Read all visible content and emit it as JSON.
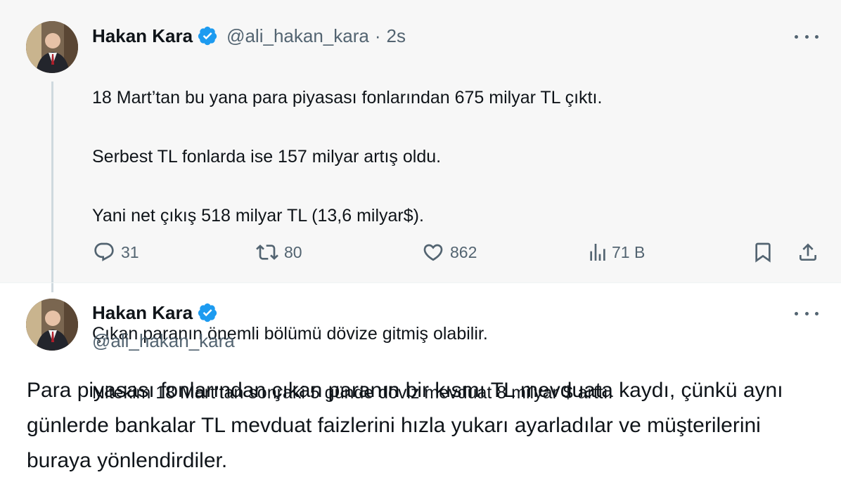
{
  "tweet1": {
    "author": {
      "name": "Hakan Kara",
      "handle": "@ali_hakan_kara",
      "time": "2s",
      "separator": "·"
    },
    "lines": [
      "18 Mart’tan bu yana para piyasası fonlarından 675 milyar TL çıktı.",
      "Serbest TL fonlarda ise 157 milyar artış oldu.",
      "Yani net çıkış 518 milyar TL (13,6 milyar$).",
      "",
      "Çıkan paranın önemli bölümü dövize gitmiş olabilir.",
      "Nitekim 18 Mart’tan sonraki 5 günde döviz mevduat 8 milyar $ arttı."
    ],
    "actions": {
      "replies": "31",
      "reposts": "80",
      "likes": "862",
      "views": "71 B"
    }
  },
  "tweet2": {
    "author": {
      "name": "Hakan Kara",
      "handle": "@ali_hakan_kara"
    },
    "text": "Para piyasası fonlarından çıkan paranın bir kısmı TL mevduata kaydı, çünkü aynı günlerde bankalar TL mevduat faizlerini hızla yukarı ayarladılar ve müşterilerini buraya yönlendirdiler."
  },
  "icons": {
    "verified": "verified-badge-icon",
    "more": "more-icon",
    "reply": "reply-icon",
    "repost": "repost-icon",
    "like": "heart-icon",
    "views": "views-icon",
    "bookmark": "bookmark-icon",
    "share": "share-icon"
  },
  "colors": {
    "verified_blue": "#1d9bf0",
    "secondary_text": "#536471",
    "primary_text": "#0f1419",
    "thread_line": "#cfd9de",
    "tweet1_bg": "#f7f7f7"
  }
}
